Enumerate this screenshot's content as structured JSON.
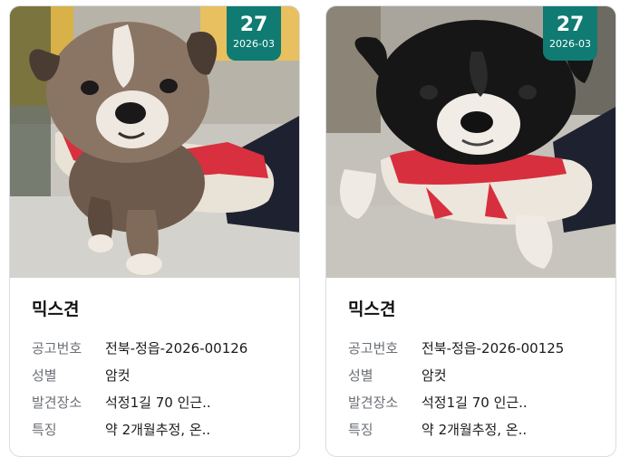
{
  "accent": "#0f7b72",
  "labels": {
    "notice_no": "공고번호",
    "sex": "성별",
    "found_place": "발견장소",
    "features": "특징"
  },
  "cards": [
    {
      "badge_day": "27",
      "badge_ym": "2026-03",
      "breed": "믹스견",
      "notice_no": "전북-정읍-2026-00126",
      "sex": "암컷",
      "found_place": "석정1길 70 인근..",
      "features": "약 2개월추정, 온.."
    },
    {
      "badge_day": "27",
      "badge_ym": "2026-03",
      "breed": "믹스견",
      "notice_no": "전북-정읍-2026-00125",
      "sex": "암컷",
      "found_place": "석정1길 70 인근..",
      "features": "약 2개월추정, 온.."
    }
  ]
}
